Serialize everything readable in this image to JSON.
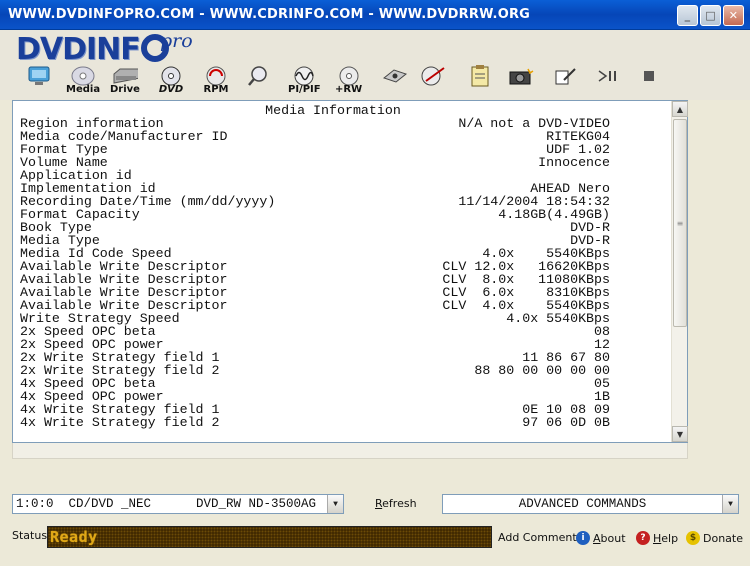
{
  "window": {
    "title": "WWW.DVDINFOPRO.COM  - WWW.CDRINFO.COM - WWW.DVDRRW.ORG",
    "buttons": {
      "minimize": "_",
      "maximize": "□",
      "close": "✕"
    }
  },
  "logo": {
    "main": "DVDINF",
    "suffix": "pro"
  },
  "toolbar": {
    "items": [
      {
        "label": "",
        "icon": "monitor-icon"
      },
      {
        "label": "Media",
        "icon": "disc-icon"
      },
      {
        "label": "Drive",
        "icon": "drive-icon"
      },
      {
        "label": "DVD",
        "icon": "dvd-icon"
      },
      {
        "label": "RPM",
        "icon": "rpm-icon"
      },
      {
        "label": "",
        "icon": "magnifier-icon"
      },
      {
        "label": "PI/PIF",
        "icon": "wave-icon"
      },
      {
        "label": "+RW",
        "icon": "rw-icon"
      },
      {
        "label": "",
        "icon": "burner-icon"
      },
      {
        "label": "",
        "icon": "disc-tool-icon"
      },
      {
        "label": "",
        "icon": "clipboard-icon"
      },
      {
        "label": "",
        "icon": "camera-icon"
      },
      {
        "label": "",
        "icon": "edit-icon"
      },
      {
        "label": "",
        "icon": "play-pause-icon"
      },
      {
        "label": "",
        "icon": "stop-icon"
      }
    ]
  },
  "media_info": {
    "title": "Media Information",
    "rows": [
      {
        "key": "Region information",
        "value": "N/A not a DVD-VIDEO"
      },
      {
        "key": "Media code/Manufacturer ID",
        "value": "RITEKG04"
      },
      {
        "key": "Format Type",
        "value": "UDF 1.02"
      },
      {
        "key": "Volume Name",
        "value": "Innocence"
      },
      {
        "key": "Application id",
        "value": ""
      },
      {
        "key": "Implementation id",
        "value": "AHEAD Nero"
      },
      {
        "key": "Recording Date/Time (mm/dd/yyyy)",
        "value": "11/14/2004 18:54:32"
      },
      {
        "key": "Format Capacity",
        "value": "4.18GB(4.49GB)"
      },
      {
        "key": "Book Type",
        "value": "DVD-R"
      },
      {
        "key": "Media Type",
        "value": "DVD-R"
      },
      {
        "key": "Media Id Code Speed",
        "value": "4.0x    5540KBps"
      },
      {
        "key": "Available Write Descriptor",
        "value": "CLV 12.0x   16620KBps"
      },
      {
        "key": "Available Write Descriptor",
        "value": "CLV  8.0x   11080KBps"
      },
      {
        "key": "Available Write Descriptor",
        "value": "CLV  6.0x    8310KBps"
      },
      {
        "key": "Available Write Descriptor",
        "value": "CLV  4.0x    5540KBps"
      },
      {
        "key": "Write Strategy Speed",
        "value": "4.0x 5540KBps"
      },
      {
        "key": "2x Speed OPC beta",
        "value": "08"
      },
      {
        "key": "2x Speed OPC power",
        "value": "12"
      },
      {
        "key": "2x Write Strategy field 1",
        "value": "11 86 67 80"
      },
      {
        "key": "2x Write Strategy field 2",
        "value": "88 80 00 00 00 00"
      },
      {
        "key": "4x Speed OPC beta",
        "value": "05"
      },
      {
        "key": "4x Speed OPC power",
        "value": "1B"
      },
      {
        "key": "4x Write Strategy field 1",
        "value": "0E 10 08 09"
      },
      {
        "key": "4x Write Strategy field 2",
        "value": "97 06 0D 0B"
      }
    ]
  },
  "drive_select": {
    "value": "1:0:0  CD/DVD _NEC      DVD_RW ND-3500AG"
  },
  "refresh": {
    "first": "R",
    "rest": "efresh"
  },
  "advanced": {
    "value": "ADVANCED COMMANDS"
  },
  "status": {
    "label": "Status",
    "text": "Ready"
  },
  "links": {
    "add_comment": "Add Comment",
    "about_first": "A",
    "about_rest": "bout",
    "help_first": "H",
    "help_rest": "elp",
    "donate": "Donate"
  }
}
